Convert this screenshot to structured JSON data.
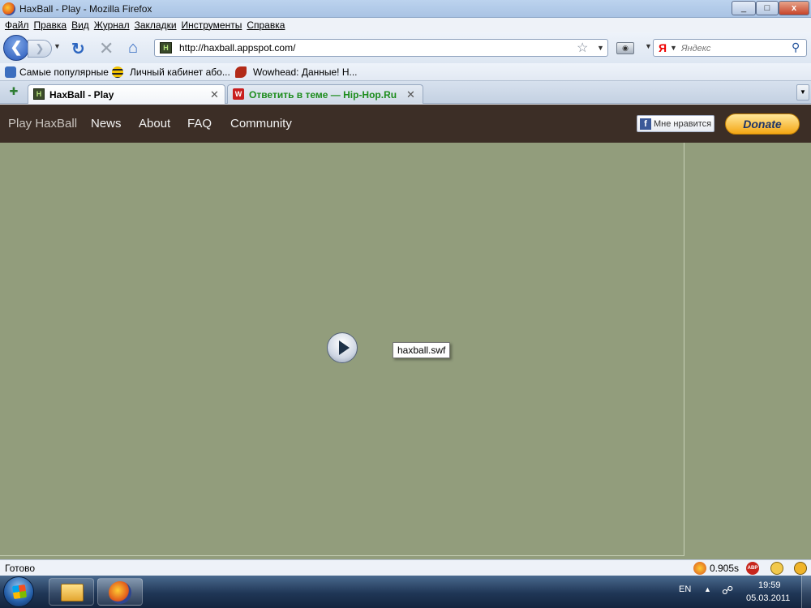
{
  "window": {
    "title": "HaxBall - Play - Mozilla Firefox",
    "controls": {
      "minimize": "_",
      "maximize": "□",
      "close": "x"
    }
  },
  "menu": {
    "items": [
      "Файл",
      "Правка",
      "Вид",
      "Журнал",
      "Закладки",
      "Инструменты",
      "Справка"
    ]
  },
  "toolbar": {
    "url": "http://haxball.appspot.com/",
    "search_placeholder": "Яндекс",
    "search_engine_glyph": "Я",
    "favicon_glyph": "H"
  },
  "bookmarks": [
    {
      "label": "Самые популярные",
      "icon": "rss-bookmark-icon",
      "color": "#3d6fbf"
    },
    {
      "label": "Личный кабинет або...",
      "icon": "beeline-icon",
      "color": "#f2c200"
    },
    {
      "label": "Wowhead: Данные! Н...",
      "icon": "wowhead-icon",
      "color": "#b22a18"
    }
  ],
  "tabs": [
    {
      "label": "HaxBall - Play",
      "active": true,
      "color": "#000000",
      "icon_glyph": "H"
    },
    {
      "label": "Ответить в теме — Hip-Hop.Ru",
      "active": false,
      "color": "#1c8c1c",
      "icon_glyph": "W"
    }
  ],
  "site": {
    "nav": [
      "Play HaxBall",
      "News",
      "About",
      "FAQ",
      "Community"
    ],
    "like_label": "Мне нравится",
    "facebook_glyph": "f",
    "donate_label": "Donate",
    "tooltip": "haxball.swf",
    "colors": {
      "nav_bg": "#3c2e26",
      "game_bg": "#929d7c",
      "donate": "#f4a613"
    }
  },
  "status": {
    "text": "Готово",
    "timing": "0.905s"
  },
  "taskbar": {
    "lang": "EN",
    "time": "19:59",
    "date": "05.03.2011"
  }
}
